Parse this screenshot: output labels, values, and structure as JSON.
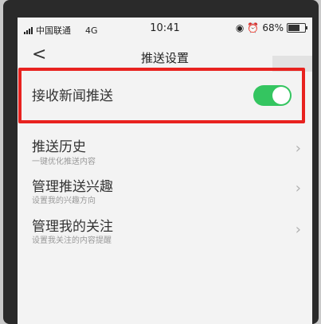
{
  "statusbar": {
    "carrier": "中国联通",
    "network": "4G",
    "time": "10:41",
    "battery": "68%",
    "battery_level": 0.68
  },
  "navbar": {
    "back_glyph": "<",
    "title": "推送设置"
  },
  "settings": [
    {
      "label": "接收新闻推送",
      "toggle_on": true
    },
    {
      "label": "推送历史",
      "sub": "一键优化推送内容"
    },
    {
      "label": "管理推送兴趣",
      "sub": "设置我的兴趣方向"
    },
    {
      "label": "管理我的关注",
      "sub": "设置我关注的内容提醒"
    }
  ],
  "chevron_glyph": "›",
  "colors": {
    "highlight": "#e8221f",
    "toggle_on": "#34c560"
  }
}
